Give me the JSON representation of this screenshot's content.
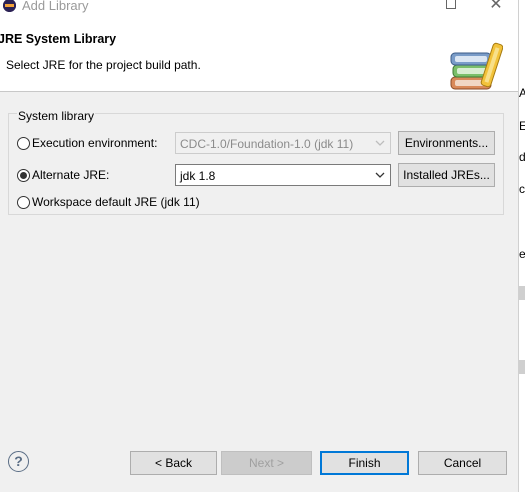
{
  "window": {
    "title": "Add Library",
    "maximize_icon": "maximize-icon",
    "close_glyph": "✕"
  },
  "header": {
    "title": "JRE System Library",
    "description": "Select JRE for the project build path.",
    "icon": "library-books-icon"
  },
  "system_library": {
    "group_label": "System library",
    "options": [
      {
        "label": "Execution environment:",
        "checked": false
      },
      {
        "label": "Alternate JRE:",
        "checked": true
      },
      {
        "label": "Workspace default JRE (jdk 11)",
        "checked": false
      }
    ],
    "execution_environment_value": "CDC-1.0/Foundation-1.0 (jdk 11)",
    "alternate_jre_value": "jdk 1.8",
    "environments_button": "Environments...",
    "installed_jres_button": "Installed JREs..."
  },
  "footer": {
    "help_glyph": "?",
    "back": "< Back",
    "next": "Next >",
    "finish": "Finish",
    "cancel": "Cancel"
  },
  "background_window": {
    "chars": [
      "A",
      "E",
      "d",
      "c",
      "e"
    ]
  },
  "colors": {
    "accent": "#0078d7",
    "dialog_bg": "#f0f0f0"
  }
}
